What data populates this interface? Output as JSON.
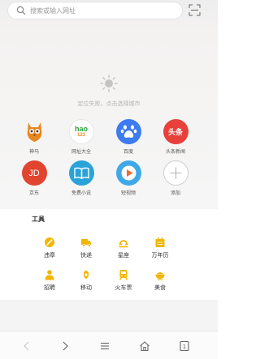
{
  "search": {
    "placeholder": "搜索或输入网址"
  },
  "weather": {
    "message": "定位失败，点击选择城市"
  },
  "apps": [
    {
      "label": "神马",
      "icon": "shenma-owl-icon"
    },
    {
      "label": "网址大全",
      "icon": "hao123-icon",
      "logo_text": "hao",
      "logo_num": "123"
    },
    {
      "label": "百度",
      "icon": "baidu-paw-icon"
    },
    {
      "label": "头条新闻",
      "icon": "toutiao-icon",
      "logo_text": "头条"
    },
    {
      "label": "京东",
      "icon": "jd-icon",
      "logo_text": "JD"
    },
    {
      "label": "免费小说",
      "icon": "book-icon"
    },
    {
      "label": "短视频",
      "icon": "play-video-icon"
    },
    {
      "label": "添加",
      "icon": "plus-icon"
    }
  ],
  "tools": {
    "title": "工具",
    "items": [
      {
        "label": "违章",
        "icon": "violation-icon"
      },
      {
        "label": "快递",
        "icon": "delivery-truck-icon"
      },
      {
        "label": "星座",
        "icon": "zodiac-icon"
      },
      {
        "label": "万年历",
        "icon": "calendar-icon"
      },
      {
        "label": "招聘",
        "icon": "recruit-person-icon"
      },
      {
        "label": "移动",
        "icon": "mobile-icon"
      },
      {
        "label": "火车票",
        "icon": "train-ticket-icon"
      },
      {
        "label": "美食",
        "icon": "food-bowl-icon"
      }
    ]
  },
  "bottom_nav": {
    "tabs_count": "1",
    "items": [
      "back-icon",
      "forward-icon",
      "menu-icon",
      "home-icon",
      "tabs-icon"
    ]
  },
  "colors": {
    "accent": "#f2b600",
    "toutiao": "#e8403b",
    "jd": "#e2452f",
    "baidu": "#3c7bf0",
    "book": "#2aa3d8",
    "video": "#3fa9e8"
  }
}
